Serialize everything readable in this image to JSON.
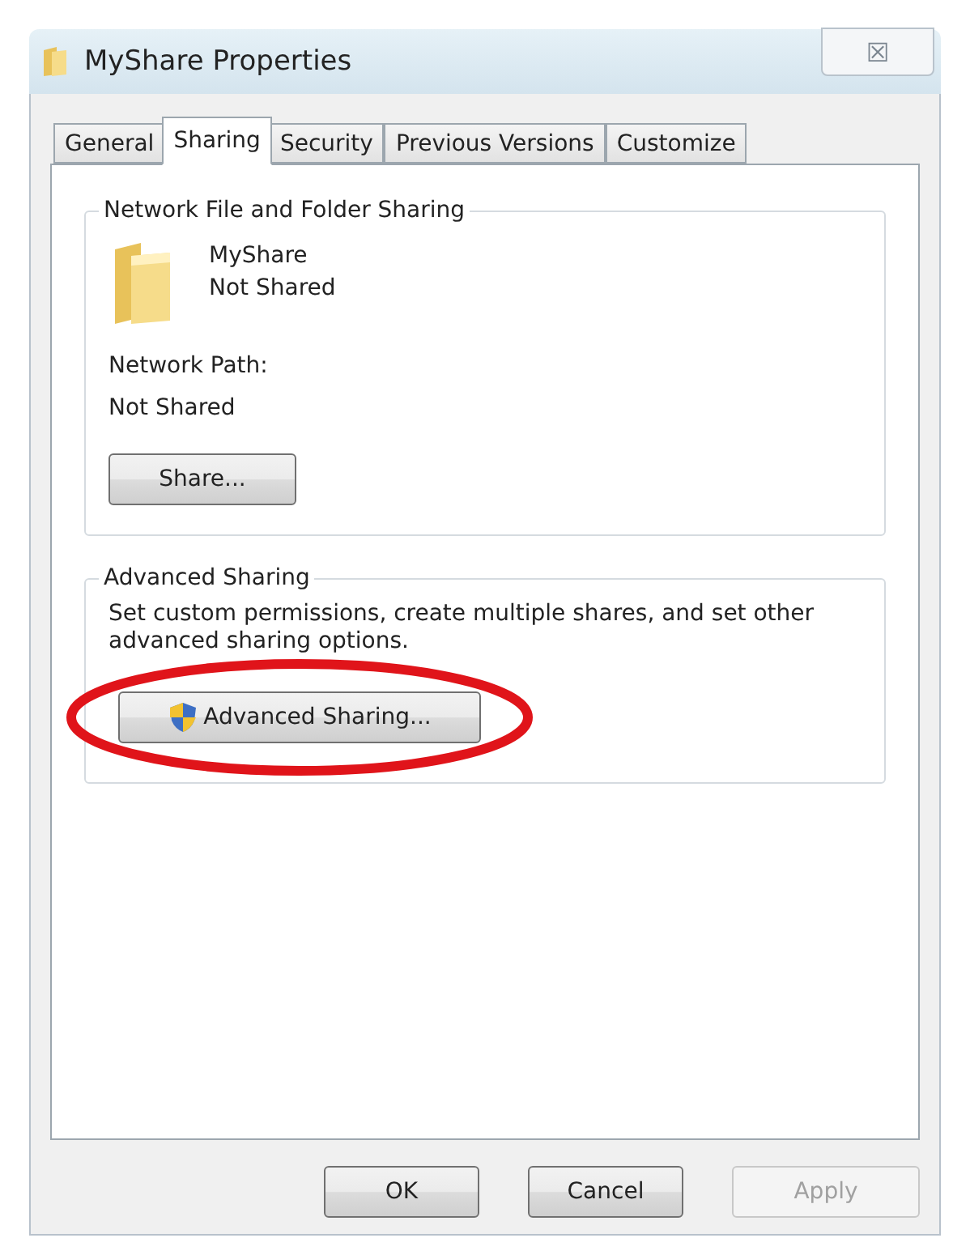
{
  "window": {
    "title": "MyShare Properties",
    "close": "☒"
  },
  "tabs": [
    {
      "label": "General",
      "selected": false
    },
    {
      "label": "Sharing",
      "selected": true
    },
    {
      "label": "Security",
      "selected": false
    },
    {
      "label": "Previous Versions",
      "selected": false
    },
    {
      "label": "Customize",
      "selected": false
    }
  ],
  "network_sharing": {
    "title": "Network File and Folder Sharing",
    "folder_name": "MyShare",
    "folder_status": "Not Shared",
    "path_label": "Network Path:",
    "path_value": "Not Shared",
    "button": "Share..."
  },
  "advanced_sharing": {
    "title": "Advanced Sharing",
    "description": "Set custom permissions, create multiple shares, and set other advanced sharing options.",
    "button": "Advanced Sharing...",
    "highlighted": true
  },
  "buttons": [
    {
      "label": "OK",
      "disabled": false
    },
    {
      "label": "Cancel",
      "disabled": false
    },
    {
      "label": "Apply",
      "disabled": true
    }
  ]
}
